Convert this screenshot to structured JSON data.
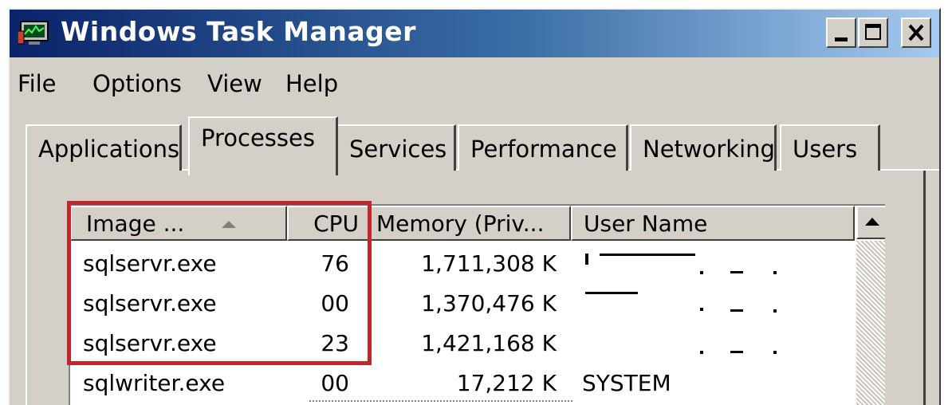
{
  "window": {
    "title": "Windows Task Manager",
    "controls": {
      "minimize": "minimize",
      "maximize": "maximize",
      "close": "close"
    }
  },
  "menu": {
    "file": "File",
    "options": "Options",
    "view": "View",
    "help": "Help"
  },
  "tabs": [
    {
      "label": "Applications"
    },
    {
      "label": "Processes",
      "active": true
    },
    {
      "label": "Services"
    },
    {
      "label": "Performance"
    },
    {
      "label": "Networking"
    },
    {
      "label": "Users"
    }
  ],
  "table": {
    "columns": {
      "image": "Image ...",
      "cpu": "CPU",
      "memory": "Memory (Priv...",
      "user": "User Name"
    },
    "sort_indicator": "ascending",
    "rows": [
      {
        "image": "sqlservr.exe",
        "cpu": "76",
        "memory": "1,711,308 K",
        "user": ""
      },
      {
        "image": "sqlservr.exe",
        "cpu": "00",
        "memory": "1,370,476 K",
        "user": ""
      },
      {
        "image": "sqlservr.exe",
        "cpu": "23",
        "memory": "1,421,168 K",
        "user": ""
      },
      {
        "image": "sqlwriter.exe",
        "cpu": "00",
        "memory": "17,212 K",
        "user": "SYSTEM"
      }
    ]
  },
  "annotation": {
    "highlight_color": "#c0262b"
  },
  "colors": {
    "titlebar_start": "#0a246a",
    "titlebar_end": "#a6caf0",
    "chrome": "#d4d0c8"
  }
}
